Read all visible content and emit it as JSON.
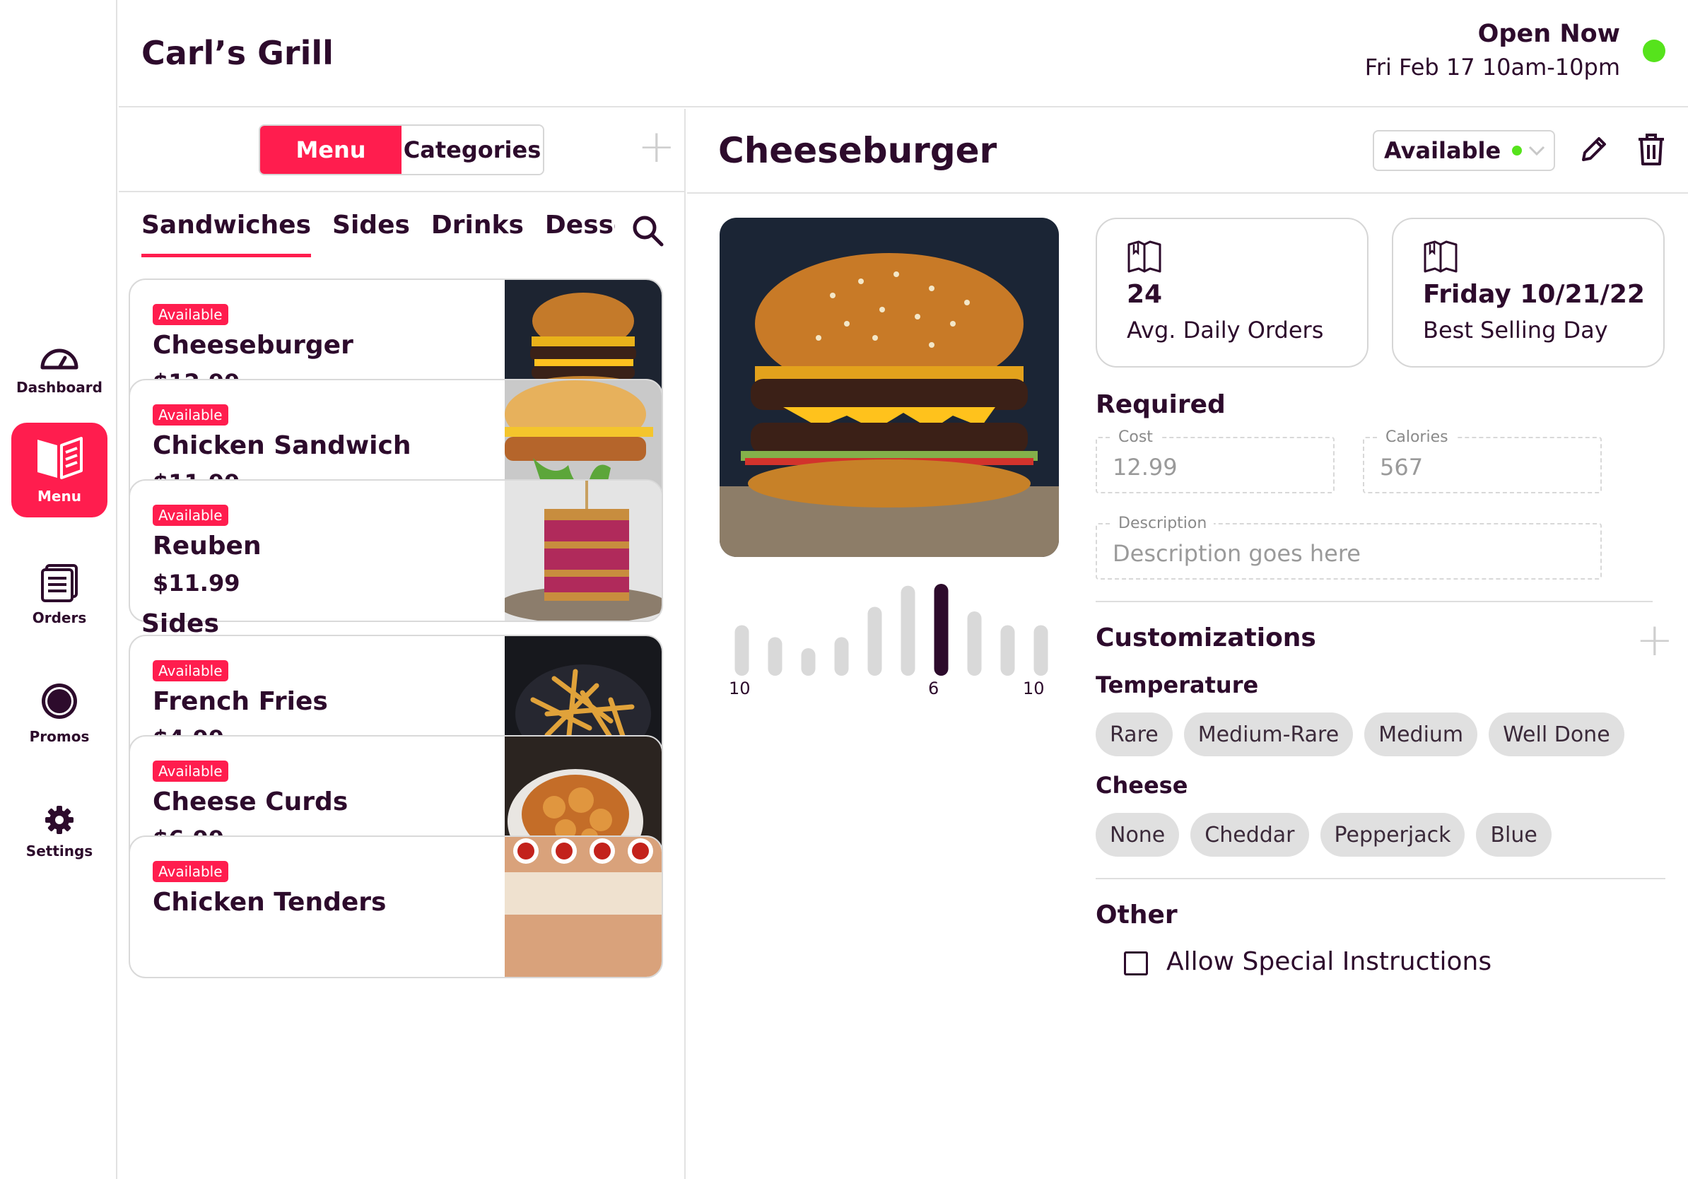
{
  "header": {
    "restaurant_name": "Carl’s Grill",
    "status_text": "Open Now",
    "hours": "Fri Feb 17 10am-10pm",
    "status_color": "#56e31c"
  },
  "nav": {
    "dashboard": "Dashboard",
    "menu": "Menu",
    "orders": "Orders",
    "promos": "Promos",
    "settings": "Settings"
  },
  "menu_pane": {
    "toggle_menu": "Menu",
    "toggle_categories": "Categories",
    "tabs": [
      "Sandwiches",
      "Sides",
      "Drinks",
      "Desserts"
    ],
    "sections": [
      {
        "title": "Sandwiches",
        "items": [
          {
            "badge": "Available",
            "name": "Cheeseburger",
            "price": "$12.99"
          },
          {
            "badge": "Available",
            "name": "Chicken Sandwich",
            "price": "$11.99"
          },
          {
            "badge": "Available",
            "name": "Reuben",
            "price": "$11.99"
          }
        ]
      },
      {
        "title": "Sides",
        "items": [
          {
            "badge": "Available",
            "name": "French Fries",
            "price": "$4.99"
          },
          {
            "badge": "Available",
            "name": "Cheese Curds",
            "price": "$6.99"
          },
          {
            "badge": "Available",
            "name": "Chicken Tenders",
            "price": ""
          }
        ]
      }
    ]
  },
  "detail": {
    "title": "Cheeseburger",
    "availability": "Available",
    "stats": [
      {
        "value": "24",
        "caption": "Avg. Daily Orders"
      },
      {
        "value": "Friday 10/21/22",
        "caption": "Best Selling Day"
      }
    ],
    "order_bars": {
      "values": [
        0.55,
        0.42,
        0.3,
        0.42,
        0.75,
        0.98,
        1.0,
        0.7,
        0.55,
        0.55
      ],
      "highlight_index": 6,
      "labels": [
        "10",
        "6",
        "10"
      ],
      "highlight_color": "#2d0b2c",
      "bar_color": "#d9d9d9"
    },
    "required_title": "Required",
    "cost_label": "Cost",
    "cost_value": "12.99",
    "calories_label": "Calories",
    "calories_value": "567",
    "description_label": "Description",
    "description_placeholder": "Description goes here",
    "customizations_title": "Customizations",
    "temperature_title": "Temperature",
    "temperature_options": [
      "Rare",
      "Medium-Rare",
      "Medium",
      "Well Done"
    ],
    "cheese_title": "Cheese",
    "cheese_options": [
      "None",
      "Cheddar",
      "Pepperjack",
      "Blue"
    ],
    "other_title": "Other",
    "special_instructions_label": "Allow Special Instructions"
  },
  "colors": {
    "accent": "#ff1d4e",
    "text": "#2d0b2c",
    "online": "#56e31c"
  }
}
